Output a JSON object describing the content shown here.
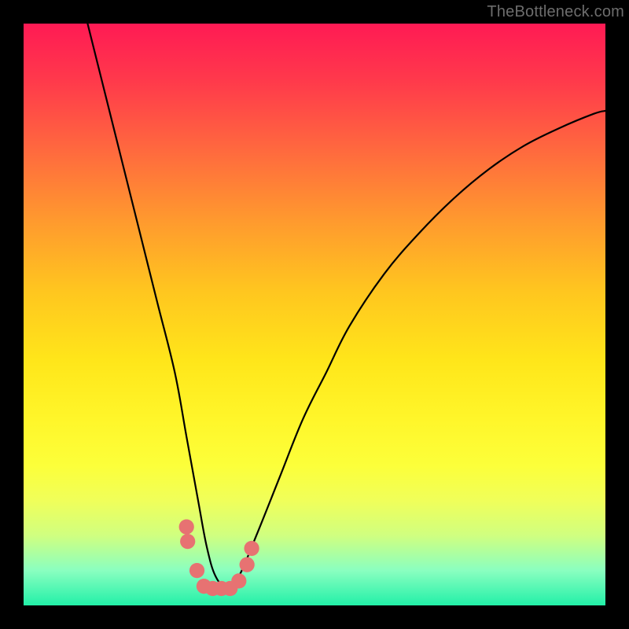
{
  "watermark": "TheBottleneck.com",
  "chart_data": {
    "type": "line",
    "title": "",
    "xlabel": "",
    "ylabel": "",
    "xlim": [
      0,
      100
    ],
    "ylim": [
      0,
      100
    ],
    "gradient_stops": [
      {
        "pos": 0,
        "color": "#ff1a54"
      },
      {
        "pos": 0.22,
        "color": "#ff6a3e"
      },
      {
        "pos": 0.46,
        "color": "#ffc61f"
      },
      {
        "pos": 0.68,
        "color": "#fff62a"
      },
      {
        "pos": 0.88,
        "color": "#d0ff80"
      },
      {
        "pos": 1.0,
        "color": "#22f0a8"
      }
    ],
    "series": [
      {
        "name": "curve",
        "color": "#000000",
        "x": [
          11,
          14,
          17,
          20,
          23,
          26,
          28,
          30,
          31.5,
          33,
          35,
          37,
          40,
          44,
          48,
          52,
          56,
          62,
          68,
          74,
          80,
          86,
          92,
          98,
          100
        ],
        "values": [
          100,
          88,
          76,
          64,
          52,
          40,
          29,
          18,
          10,
          5,
          3,
          5,
          12,
          22,
          32,
          40,
          48,
          57,
          64,
          70,
          75,
          79,
          82,
          84.5,
          85
        ]
      }
    ],
    "markers": {
      "color": "#e77272",
      "radius_pct": 1.3,
      "points": [
        {
          "x": 28.0,
          "y": 13.5
        },
        {
          "x": 28.2,
          "y": 11.0
        },
        {
          "x": 29.8,
          "y": 6.0
        },
        {
          "x": 31.0,
          "y": 3.3
        },
        {
          "x": 32.5,
          "y": 2.9
        },
        {
          "x": 34.0,
          "y": 2.9
        },
        {
          "x": 35.5,
          "y": 2.9
        },
        {
          "x": 37.0,
          "y": 4.2
        },
        {
          "x": 38.4,
          "y": 7.0
        },
        {
          "x": 39.2,
          "y": 9.8
        }
      ]
    }
  }
}
